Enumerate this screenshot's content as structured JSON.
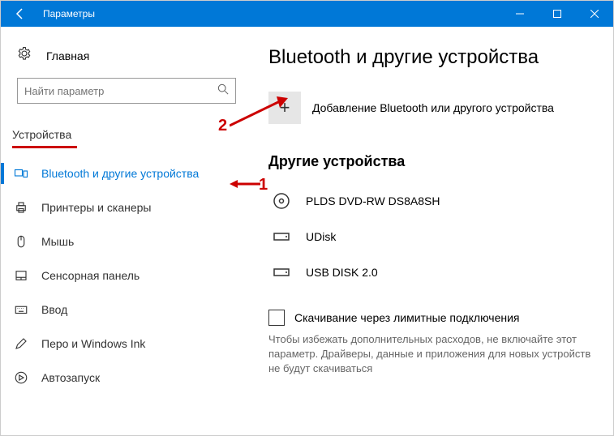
{
  "titlebar": {
    "title": "Параметры"
  },
  "sidebar": {
    "home": "Главная",
    "search_placeholder": "Найти параметр",
    "category": "Устройства",
    "items": [
      {
        "label": "Bluetooth и другие устройства"
      },
      {
        "label": "Принтеры и сканеры"
      },
      {
        "label": "Мышь"
      },
      {
        "label": "Сенсорная панель"
      },
      {
        "label": "Ввод"
      },
      {
        "label": "Перо и Windows Ink"
      },
      {
        "label": "Автозапуск"
      }
    ]
  },
  "main": {
    "title": "Bluetooth и другие устройства",
    "add_label": "Добавление Bluetooth или другого устройства",
    "section_other": "Другие устройства",
    "devices": [
      {
        "name": "PLDS DVD-RW DS8A8SH"
      },
      {
        "name": "UDisk"
      },
      {
        "name": "USB DISK 2.0"
      }
    ],
    "metered_label": "Скачивание через лимитные подключения",
    "metered_desc": "Чтобы избежать дополнительных расходов, не включайте этот параметр. Драйверы, данные и приложения для новых устройств не будут скачиваться"
  },
  "annotations": {
    "one": "1",
    "two": "2"
  }
}
